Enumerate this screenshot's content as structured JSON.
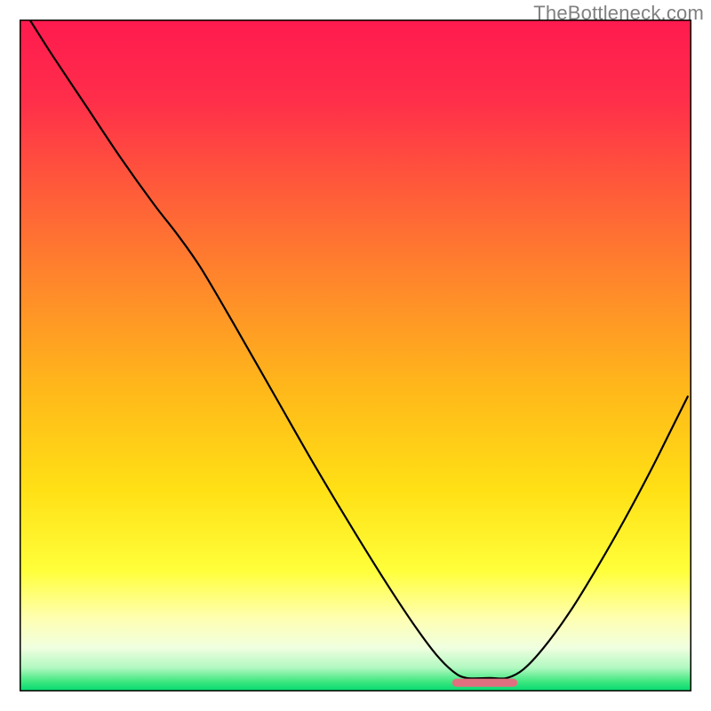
{
  "watermark": "TheBottleneck.com",
  "chart_data": {
    "type": "line",
    "title": "",
    "xlabel": "",
    "ylabel": "",
    "xlim": [
      0,
      100
    ],
    "ylim": [
      0,
      100
    ],
    "gradient_stops": [
      {
        "offset": 0.0,
        "color": "#ff1a4f"
      },
      {
        "offset": 0.12,
        "color": "#ff2e4a"
      },
      {
        "offset": 0.25,
        "color": "#ff5a3a"
      },
      {
        "offset": 0.4,
        "color": "#ff8a2a"
      },
      {
        "offset": 0.55,
        "color": "#ffb81a"
      },
      {
        "offset": 0.7,
        "color": "#ffe015"
      },
      {
        "offset": 0.82,
        "color": "#ffff3a"
      },
      {
        "offset": 0.89,
        "color": "#ffffb0"
      },
      {
        "offset": 0.935,
        "color": "#f0ffe0"
      },
      {
        "offset": 0.965,
        "color": "#b0f8c0"
      },
      {
        "offset": 0.985,
        "color": "#40e880"
      },
      {
        "offset": 1.0,
        "color": "#00d870"
      }
    ],
    "curve_points": [
      {
        "x": 1.5,
        "y": 100.0
      },
      {
        "x": 5.0,
        "y": 94.5
      },
      {
        "x": 10.0,
        "y": 87.0
      },
      {
        "x": 15.0,
        "y": 79.5
      },
      {
        "x": 20.0,
        "y": 72.5
      },
      {
        "x": 23.5,
        "y": 68.0
      },
      {
        "x": 27.0,
        "y": 63.0
      },
      {
        "x": 32.0,
        "y": 54.5
      },
      {
        "x": 38.0,
        "y": 44.0
      },
      {
        "x": 44.0,
        "y": 33.5
      },
      {
        "x": 50.0,
        "y": 23.5
      },
      {
        "x": 55.0,
        "y": 15.5
      },
      {
        "x": 59.0,
        "y": 9.5
      },
      {
        "x": 62.0,
        "y": 5.5
      },
      {
        "x": 64.5,
        "y": 3.0
      },
      {
        "x": 66.5,
        "y": 2.0
      },
      {
        "x": 70.0,
        "y": 2.0
      },
      {
        "x": 72.5,
        "y": 2.0
      },
      {
        "x": 75.0,
        "y": 3.3
      },
      {
        "x": 78.0,
        "y": 6.5
      },
      {
        "x": 82.0,
        "y": 12.0
      },
      {
        "x": 86.0,
        "y": 18.5
      },
      {
        "x": 90.0,
        "y": 25.5
      },
      {
        "x": 94.0,
        "y": 33.0
      },
      {
        "x": 97.5,
        "y": 40.0
      },
      {
        "x": 99.5,
        "y": 44.0
      }
    ],
    "bottom_marker": {
      "x_start": 65.0,
      "x_end": 73.5,
      "y": 1.3,
      "color": "#e07080",
      "thickness": 1.2
    }
  }
}
